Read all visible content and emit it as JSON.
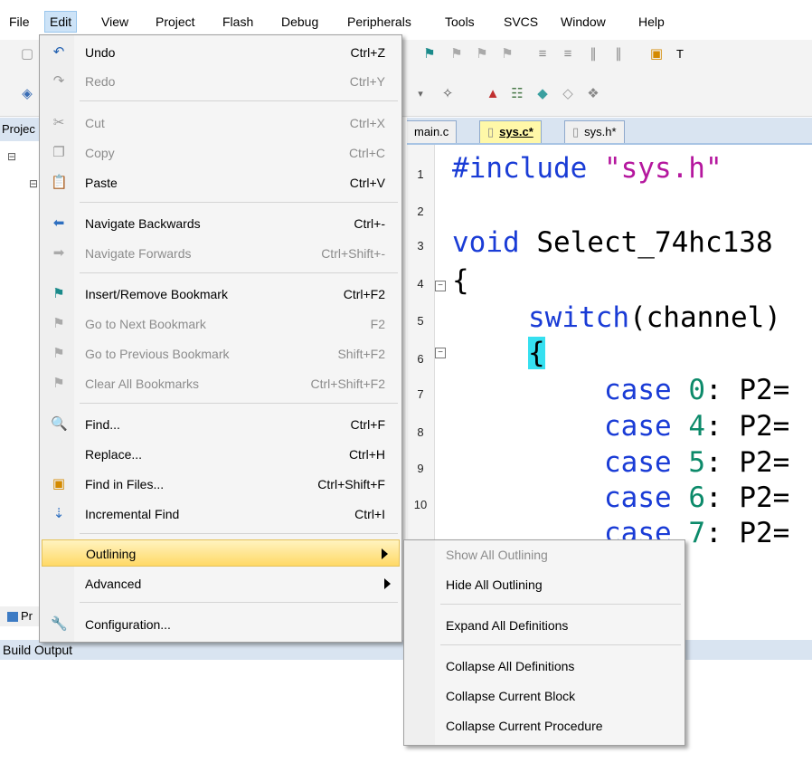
{
  "menubar": {
    "items": [
      "File",
      "Edit",
      "View",
      "Project",
      "Flash",
      "Debug",
      "Peripherals",
      "Tools",
      "SVCS",
      "Window",
      "Help"
    ]
  },
  "project_panel": {
    "header": "Projec",
    "bottom_tab": "Pr"
  },
  "editor": {
    "tabs": [
      "main.c",
      "sys.c*",
      "sys.h*"
    ],
    "line_numbers": [
      "1",
      "2",
      "3",
      "4",
      "5",
      "6",
      "7",
      "8",
      "9",
      "10"
    ],
    "code": {
      "l1_kw": "#include",
      "l1_str": "\"sys.h\"",
      "l3_kw": "void",
      "l3_rest": " Select_74hc138",
      "l4": "{",
      "l5_kw": "switch",
      "l5_rest": "(channel)",
      "l6": "{",
      "case_kw": "case",
      "case_tail": ": P2=",
      "cases": [
        "0",
        "4",
        "5",
        "6",
        "7"
      ]
    }
  },
  "edit_menu": {
    "items": [
      {
        "label": "Undo",
        "shortcut": "Ctrl+Z",
        "disabled": false,
        "icon": "undo-icon"
      },
      {
        "label": "Redo",
        "shortcut": "Ctrl+Y",
        "disabled": true,
        "icon": "redo-icon"
      },
      {
        "label": "Cut",
        "shortcut": "Ctrl+X",
        "disabled": true,
        "icon": "cut-icon"
      },
      {
        "label": "Copy",
        "shortcut": "Ctrl+C",
        "disabled": true,
        "icon": "copy-icon"
      },
      {
        "label": "Paste",
        "shortcut": "Ctrl+V",
        "disabled": false,
        "icon": "paste-icon"
      },
      {
        "label": "Navigate Backwards",
        "shortcut": "Ctrl+-",
        "disabled": false,
        "icon": "arrow-left-icon"
      },
      {
        "label": "Navigate Forwards",
        "shortcut": "Ctrl+Shift+-",
        "disabled": true,
        "icon": "arrow-right-icon"
      },
      {
        "label": "Insert/Remove Bookmark",
        "shortcut": "Ctrl+F2",
        "disabled": false,
        "icon": "bookmark-flag-icon"
      },
      {
        "label": "Go to Next Bookmark",
        "shortcut": "F2",
        "disabled": true,
        "icon": "next-bookmark-icon"
      },
      {
        "label": "Go to Previous Bookmark",
        "shortcut": "Shift+F2",
        "disabled": true,
        "icon": "previous-bookmark-icon"
      },
      {
        "label": "Clear All Bookmarks",
        "shortcut": "Ctrl+Shift+F2",
        "disabled": true,
        "icon": "clear-bookmarks-icon"
      },
      {
        "label": "Find...",
        "shortcut": "Ctrl+F",
        "disabled": false,
        "icon": "find-icon"
      },
      {
        "label": "Replace...",
        "shortcut": "Ctrl+H",
        "disabled": false,
        "icon": ""
      },
      {
        "label": "Find in Files...",
        "shortcut": "Ctrl+Shift+F",
        "disabled": false,
        "icon": "find-in-files-icon"
      },
      {
        "label": "Incremental Find",
        "shortcut": "Ctrl+I",
        "disabled": false,
        "icon": "incremental-find-icon"
      },
      {
        "label": "Outlining",
        "shortcut": "",
        "disabled": false,
        "icon": ""
      },
      {
        "label": "Advanced",
        "shortcut": "",
        "disabled": false,
        "icon": ""
      },
      {
        "label": "Configuration...",
        "shortcut": "",
        "disabled": false,
        "icon": "wrench-icon"
      }
    ]
  },
  "outlining_submenu": {
    "items": [
      {
        "label": "Show All Outlining",
        "disabled": true
      },
      {
        "label": "Hide All Outlining",
        "disabled": false
      },
      {
        "label": "Expand All Definitions",
        "disabled": false
      },
      {
        "label": "Collapse All Definitions",
        "disabled": false
      },
      {
        "label": "Collapse Current Block",
        "disabled": false
      },
      {
        "label": "Collapse Current Procedure",
        "disabled": false
      }
    ]
  },
  "build_output": {
    "title": "Build Output"
  }
}
